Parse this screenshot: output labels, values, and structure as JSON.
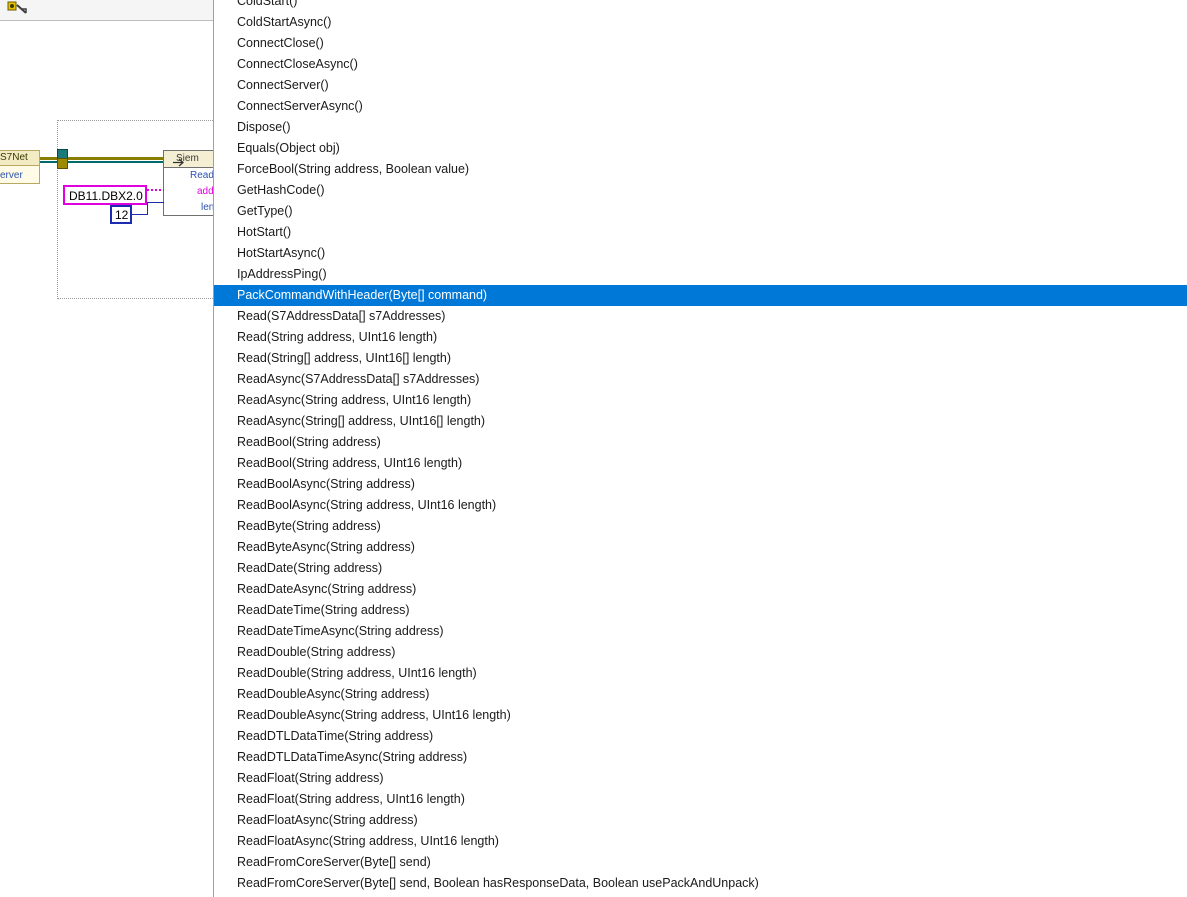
{
  "diagram": {
    "connection_node": {
      "title": "S7Net",
      "subtitle": "erver"
    },
    "invoke_node": {
      "title": "Siem",
      "method": "Read",
      "param_address": "add",
      "param_length": "len"
    },
    "string_constant": "DB11.DBX2.0",
    "numeric_constant": "12"
  },
  "dropdown": {
    "selected_index": 14,
    "accent_color": "#0078d7",
    "items": [
      "ColdStart()",
      "ColdStartAsync()",
      "ConnectClose()",
      "ConnectCloseAsync()",
      "ConnectServer()",
      "ConnectServerAsync()",
      "Dispose()",
      "Equals(Object obj)",
      "ForceBool(String address, Boolean value)",
      "GetHashCode()",
      "GetType()",
      "HotStart()",
      "HotStartAsync()",
      "IpAddressPing()",
      "PackCommandWithHeader(Byte[] command)",
      "Read(S7AddressData[] s7Addresses)",
      "Read(String address, UInt16 length)",
      "Read(String[] address, UInt16[] length)",
      "ReadAsync(S7AddressData[] s7Addresses)",
      "ReadAsync(String address, UInt16 length)",
      "ReadAsync(String[] address, UInt16[] length)",
      "ReadBool(String address)",
      "ReadBool(String address, UInt16 length)",
      "ReadBoolAsync(String address)",
      "ReadBoolAsync(String address, UInt16 length)",
      "ReadByte(String address)",
      "ReadByteAsync(String address)",
      "ReadDate(String address)",
      "ReadDateAsync(String address)",
      "ReadDateTime(String address)",
      "ReadDateTimeAsync(String address)",
      "ReadDouble(String address)",
      "ReadDouble(String address, UInt16 length)",
      "ReadDoubleAsync(String address)",
      "ReadDoubleAsync(String address, UInt16 length)",
      "ReadDTLDataTime(String address)",
      "ReadDTLDataTimeAsync(String address)",
      "ReadFloat(String address)",
      "ReadFloat(String address, UInt16 length)",
      "ReadFloatAsync(String address)",
      "ReadFloatAsync(String address, UInt16 length)",
      "ReadFromCoreServer(Byte[] send)",
      "ReadFromCoreServer(Byte[] send, Boolean hasResponseData, Boolean usePackAndUnpack)"
    ]
  }
}
